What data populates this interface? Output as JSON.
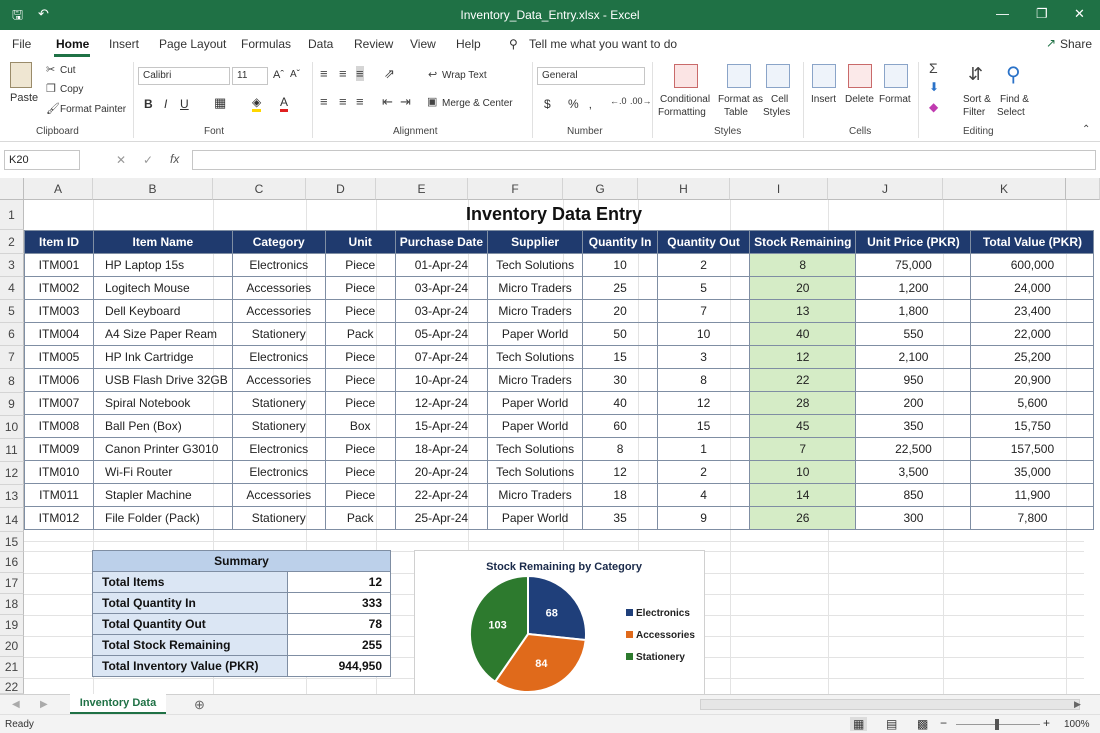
{
  "titlebar": {
    "title": "Inventory_Data_Entry.xlsx  -  Excel"
  },
  "menu": [
    "File",
    "Home",
    "Insert",
    "Page Layout",
    "Formulas",
    "Data",
    "Review",
    "View",
    "Help"
  ],
  "tell_me": "Tell me what you want to do",
  "share": "Share",
  "ribbon": {
    "paste": "Paste",
    "cut": "Cut",
    "copy": "Copy",
    "format_painter": "Format Painter",
    "font_name": "Calibri",
    "font_size": "11",
    "wrap_text": "Wrap Text",
    "merge_center": "Merge & Center",
    "number_format": "General",
    "conditional": "Conditional",
    "formatting": "Formatting",
    "format_as": "Format as",
    "table": "Table",
    "cell": "Cell",
    "styles": "Styles",
    "insert": "Insert",
    "delete": "Delete",
    "format": "Format",
    "sort": "Sort &",
    "filter": "Filter",
    "find": "Find &",
    "select": "Select",
    "groups": {
      "clipboard": "Clipboard",
      "font": "Font",
      "alignment": "Alignment",
      "number": "Number",
      "styles": "Styles",
      "cells": "Cells",
      "editing": "Editing"
    }
  },
  "formula_bar": {
    "name_box": "K20",
    "formula": ""
  },
  "columns": [
    "A",
    "B",
    "C",
    "D",
    "E",
    "F",
    "G",
    "H",
    "I",
    "J",
    "K"
  ],
  "rows": [
    "1",
    "2",
    "3",
    "4",
    "5",
    "6",
    "7",
    "8",
    "9",
    "10",
    "11",
    "12",
    "13",
    "14",
    "15",
    "16",
    "17",
    "18",
    "19",
    "20",
    "21",
    "22"
  ],
  "sheet": {
    "title": "Inventory Data Entry",
    "headers": [
      "Item ID",
      "Item Name",
      "Category",
      "Unit",
      "Purchase Date",
      "Supplier",
      "Quantity In",
      "Quantity Out",
      "Stock Remaining",
      "Unit Price (PKR)",
      "Total Value (PKR)"
    ],
    "rows": [
      [
        "ITM001",
        "HP Laptop 15s",
        "Electronics",
        "Piece",
        "01-Apr-24",
        "Tech Solutions",
        "10",
        "2",
        "8",
        "75,000",
        "600,000"
      ],
      [
        "ITM002",
        "Logitech Mouse",
        "Accessories",
        "Piece",
        "03-Apr-24",
        "Micro Traders",
        "25",
        "5",
        "20",
        "1,200",
        "24,000"
      ],
      [
        "ITM003",
        "Dell Keyboard",
        "Accessories",
        "Piece",
        "03-Apr-24",
        "Micro Traders",
        "20",
        "7",
        "13",
        "1,800",
        "23,400"
      ],
      [
        "ITM004",
        "A4 Size Paper Ream",
        "Stationery",
        "Pack",
        "05-Apr-24",
        "Paper World",
        "50",
        "10",
        "40",
        "550",
        "22,000"
      ],
      [
        "ITM005",
        "HP Ink Cartridge",
        "Electronics",
        "Piece",
        "07-Apr-24",
        "Tech Solutions",
        "15",
        "3",
        "12",
        "2,100",
        "25,200"
      ],
      [
        "ITM006",
        "USB Flash Drive 32GB",
        "Accessories",
        "Piece",
        "10-Apr-24",
        "Micro Traders",
        "30",
        "8",
        "22",
        "950",
        "20,900"
      ],
      [
        "ITM007",
        "Spiral Notebook",
        "Stationery",
        "Piece",
        "12-Apr-24",
        "Paper World",
        "40",
        "12",
        "28",
        "200",
        "5,600"
      ],
      [
        "ITM008",
        "Ball Pen (Box)",
        "Stationery",
        "Box",
        "15-Apr-24",
        "Paper World",
        "60",
        "15",
        "45",
        "350",
        "15,750"
      ],
      [
        "ITM009",
        "Canon Printer G3010",
        "Electronics",
        "Piece",
        "18-Apr-24",
        "Tech Solutions",
        "8",
        "1",
        "7",
        "22,500",
        "157,500"
      ],
      [
        "ITM010",
        "Wi-Fi Router",
        "Electronics",
        "Piece",
        "20-Apr-24",
        "Tech Solutions",
        "12",
        "2",
        "10",
        "3,500",
        "35,000"
      ],
      [
        "ITM011",
        "Stapler Machine",
        "Accessories",
        "Piece",
        "22-Apr-24",
        "Micro Traders",
        "18",
        "4",
        "14",
        "850",
        "11,900"
      ],
      [
        "ITM012",
        "File Folder (Pack)",
        "Stationery",
        "Pack",
        "25-Apr-24",
        "Paper World",
        "35",
        "9",
        "26",
        "300",
        "7,800"
      ]
    ],
    "summary": {
      "title": "Summary",
      "items": [
        {
          "label": "Total Items",
          "value": "12"
        },
        {
          "label": "Total Quantity In",
          "value": "333"
        },
        {
          "label": "Total Quantity Out",
          "value": "78"
        },
        {
          "label": "Total Stock Remaining",
          "value": "255"
        },
        {
          "label": "Total Inventory Value (PKR)",
          "value": "944,950"
        }
      ]
    }
  },
  "chart_data": {
    "type": "pie",
    "title": "Stock Remaining by Category",
    "categories": [
      "Electronics",
      "Accessories",
      "Stationery"
    ],
    "values": [
      68,
      84,
      103
    ],
    "colors": [
      "#1f3f7a",
      "#e06a1b",
      "#2d7a2e"
    ],
    "legend": "right"
  },
  "tabs": {
    "active": "Inventory Data"
  },
  "status": {
    "ready": "Ready",
    "zoom": "100%"
  }
}
